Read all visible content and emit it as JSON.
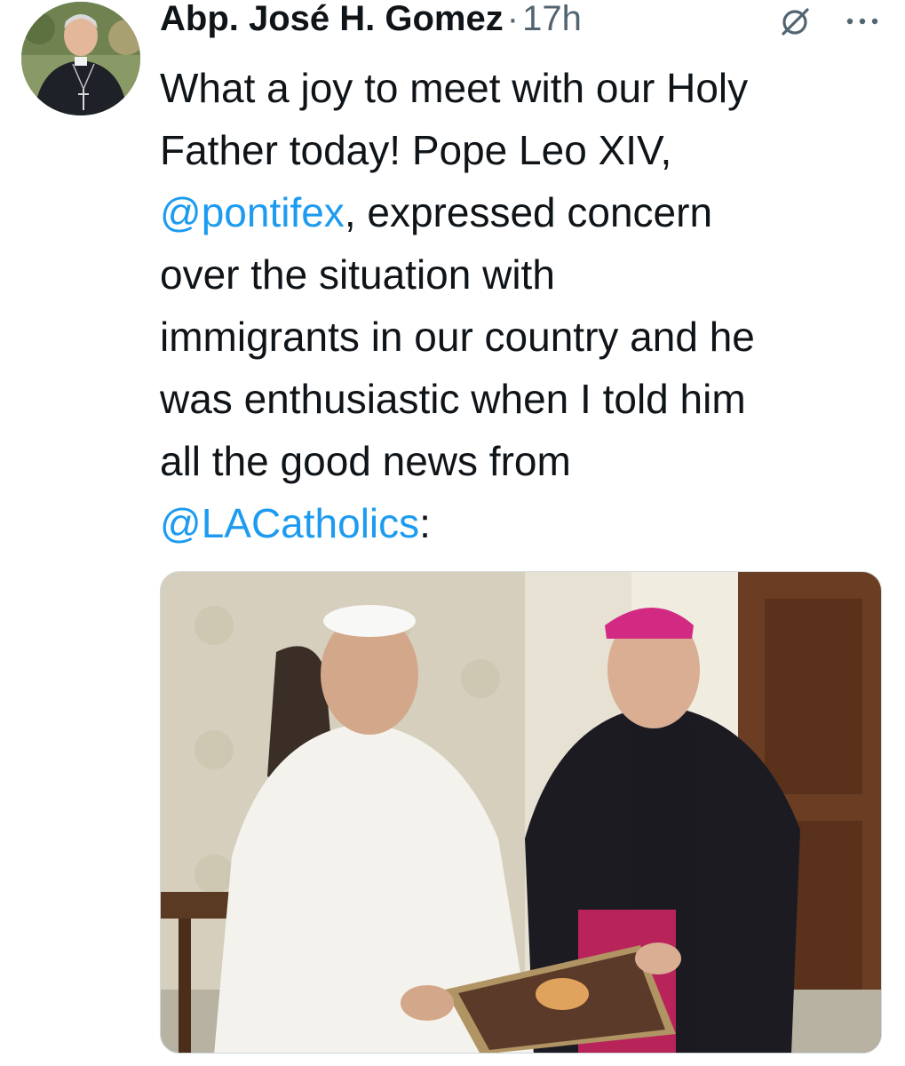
{
  "tweet": {
    "author": {
      "display_name": "Abp. José H. Gomez",
      "avatar_icon": "person-avatar"
    },
    "separator": "·",
    "timestamp": "17h",
    "text_parts": [
      {
        "text": "What a joy to meet with our Holy\nFather today! Pope Leo XIV,\n",
        "type": "plain"
      },
      {
        "text": "@pontifex",
        "type": "mention"
      },
      {
        "text": ", expressed concern\nover the situation with\nimmigrants in our country and he\nwas enthusiastic when I told him\nall the good news from\n",
        "type": "plain"
      },
      {
        "text": "@LACatholics",
        "type": "mention"
      },
      {
        "text": ":",
        "type": "plain"
      }
    ],
    "actions": {
      "grok_icon": "grok-slash-icon",
      "more_icon": "more-dots-icon"
    },
    "media": {
      "type": "photo",
      "description_icon": "photo-image"
    }
  },
  "colors": {
    "text": "#0f1419",
    "secondary": "#536471",
    "link": "#1d9bf0"
  }
}
